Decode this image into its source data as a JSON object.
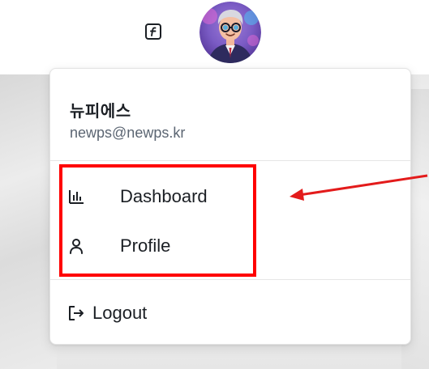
{
  "header": {
    "feature_icon": "feature-flag-icon",
    "avatar": "user-avatar"
  },
  "user": {
    "name": "뉴피에스",
    "email": "newps@newps.kr"
  },
  "menu": {
    "items": [
      {
        "label": "Dashboard",
        "icon": "bar-chart-icon"
      },
      {
        "label": "Profile",
        "icon": "user-icon"
      }
    ],
    "logout": {
      "label": "Logout",
      "icon": "logout-icon"
    }
  },
  "annotation": {
    "box_color": "#ff0000",
    "arrow_color": "#e31b1b"
  },
  "colors": {
    "text_primary": "#1b1f24",
    "text_secondary": "#5b6572"
  }
}
